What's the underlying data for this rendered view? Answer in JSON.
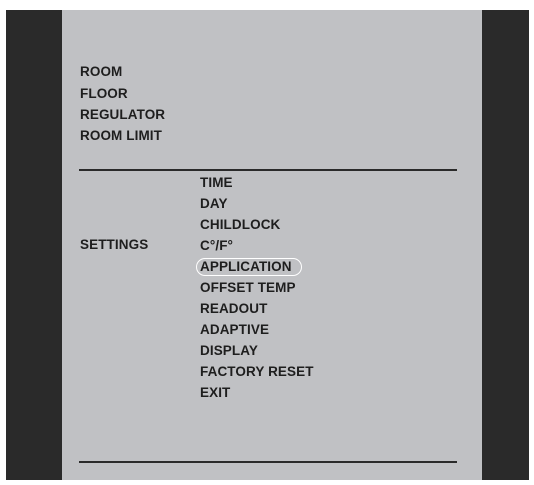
{
  "top_menu": {
    "items": [
      "ROOM",
      "FLOOR",
      "REGULATOR",
      "ROOM LIMIT"
    ]
  },
  "settings": {
    "label": "SETTINGS",
    "items": [
      "TIME",
      "DAY",
      "CHILDLOCK",
      "C°/F°",
      "APPLICATION",
      "OFFSET TEMP",
      "READOUT",
      "ADAPTIVE",
      "DISPLAY",
      "FACTORY RESET",
      "EXIT"
    ],
    "selected_item": "APPLICATION"
  },
  "colors": {
    "bezel": "#2a2a2a",
    "screen_background": "#c0c1c4",
    "text": "#1e1e1e",
    "selection_ring": "#ffffff"
  }
}
